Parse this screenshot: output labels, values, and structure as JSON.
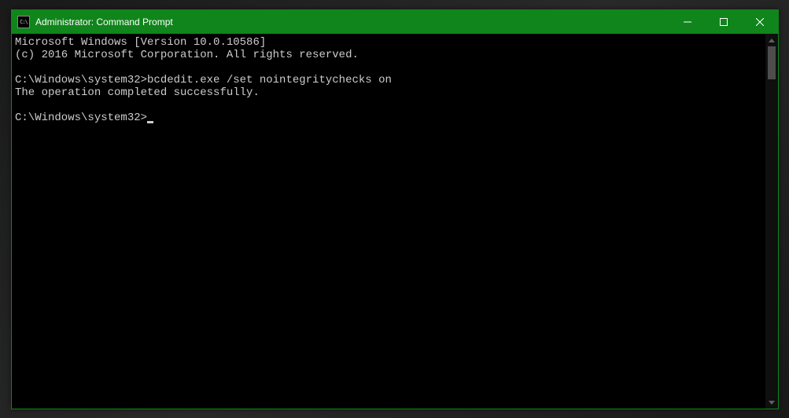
{
  "window": {
    "title": "Administrator: Command Prompt",
    "icon_glyph": "C:\\"
  },
  "terminal": {
    "lines": [
      "Microsoft Windows [Version 10.0.10586]",
      "(c) 2016 Microsoft Corporation. All rights reserved.",
      "",
      "C:\\Windows\\system32>bcdedit.exe /set nointegritychecks on",
      "The operation completed successfully.",
      "",
      "C:\\Windows\\system32>"
    ],
    "prompt_path": "C:\\Windows\\system32>",
    "last_command": "bcdedit.exe /set nointegritychecks on",
    "result_message": "The operation completed successfully."
  },
  "colors": {
    "titlebar_bg": "#10851b",
    "terminal_bg": "#000000",
    "terminal_fg": "#cccccc"
  }
}
